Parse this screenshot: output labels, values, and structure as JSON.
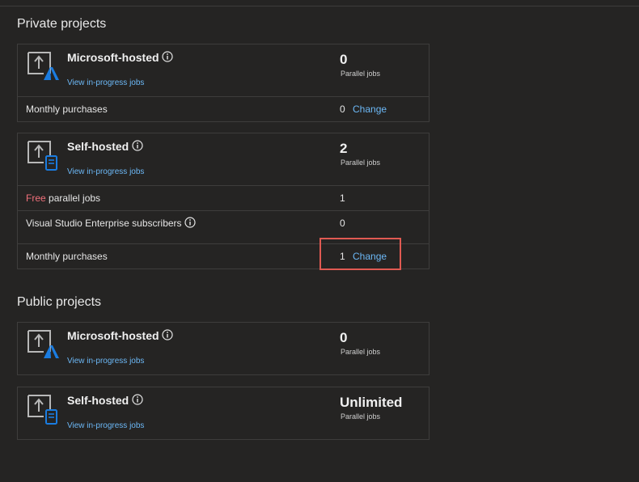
{
  "private": {
    "title": "Private projects",
    "microsoft_hosted": {
      "name": "Microsoft-hosted",
      "link": "View in-progress jobs",
      "jobs": "0",
      "jobs_label": "Parallel jobs",
      "monthly_label": "Monthly purchases",
      "monthly_value": "0",
      "change_label": "Change"
    },
    "self_hosted": {
      "name": "Self-hosted",
      "link": "View in-progress jobs",
      "jobs": "2",
      "jobs_label": "Parallel jobs",
      "free_word": "Free",
      "free_rest": " parallel jobs",
      "free_value": "1",
      "vs_label": "Visual Studio Enterprise subscribers",
      "vs_value": "0",
      "monthly_label": "Monthly purchases",
      "monthly_value": "1",
      "change_label": "Change"
    }
  },
  "public": {
    "title": "Public projects",
    "microsoft_hosted": {
      "name": "Microsoft-hosted",
      "link": "View in-progress jobs",
      "jobs": "0",
      "jobs_label": "Parallel jobs"
    },
    "self_hosted": {
      "name": "Self-hosted",
      "link": "View in-progress jobs",
      "jobs": "Unlimited",
      "jobs_label": "Parallel jobs"
    }
  },
  "icons": {
    "agent": "build-agent-icon",
    "azure": "azure-logo-icon",
    "machine": "self-hosted-machine-icon",
    "info": "info-icon"
  },
  "colors": {
    "background": "#252423",
    "link": "#6cb8f6",
    "free": "#f1707b",
    "highlight": "#e05a52",
    "azure": "#1a7ce0"
  }
}
